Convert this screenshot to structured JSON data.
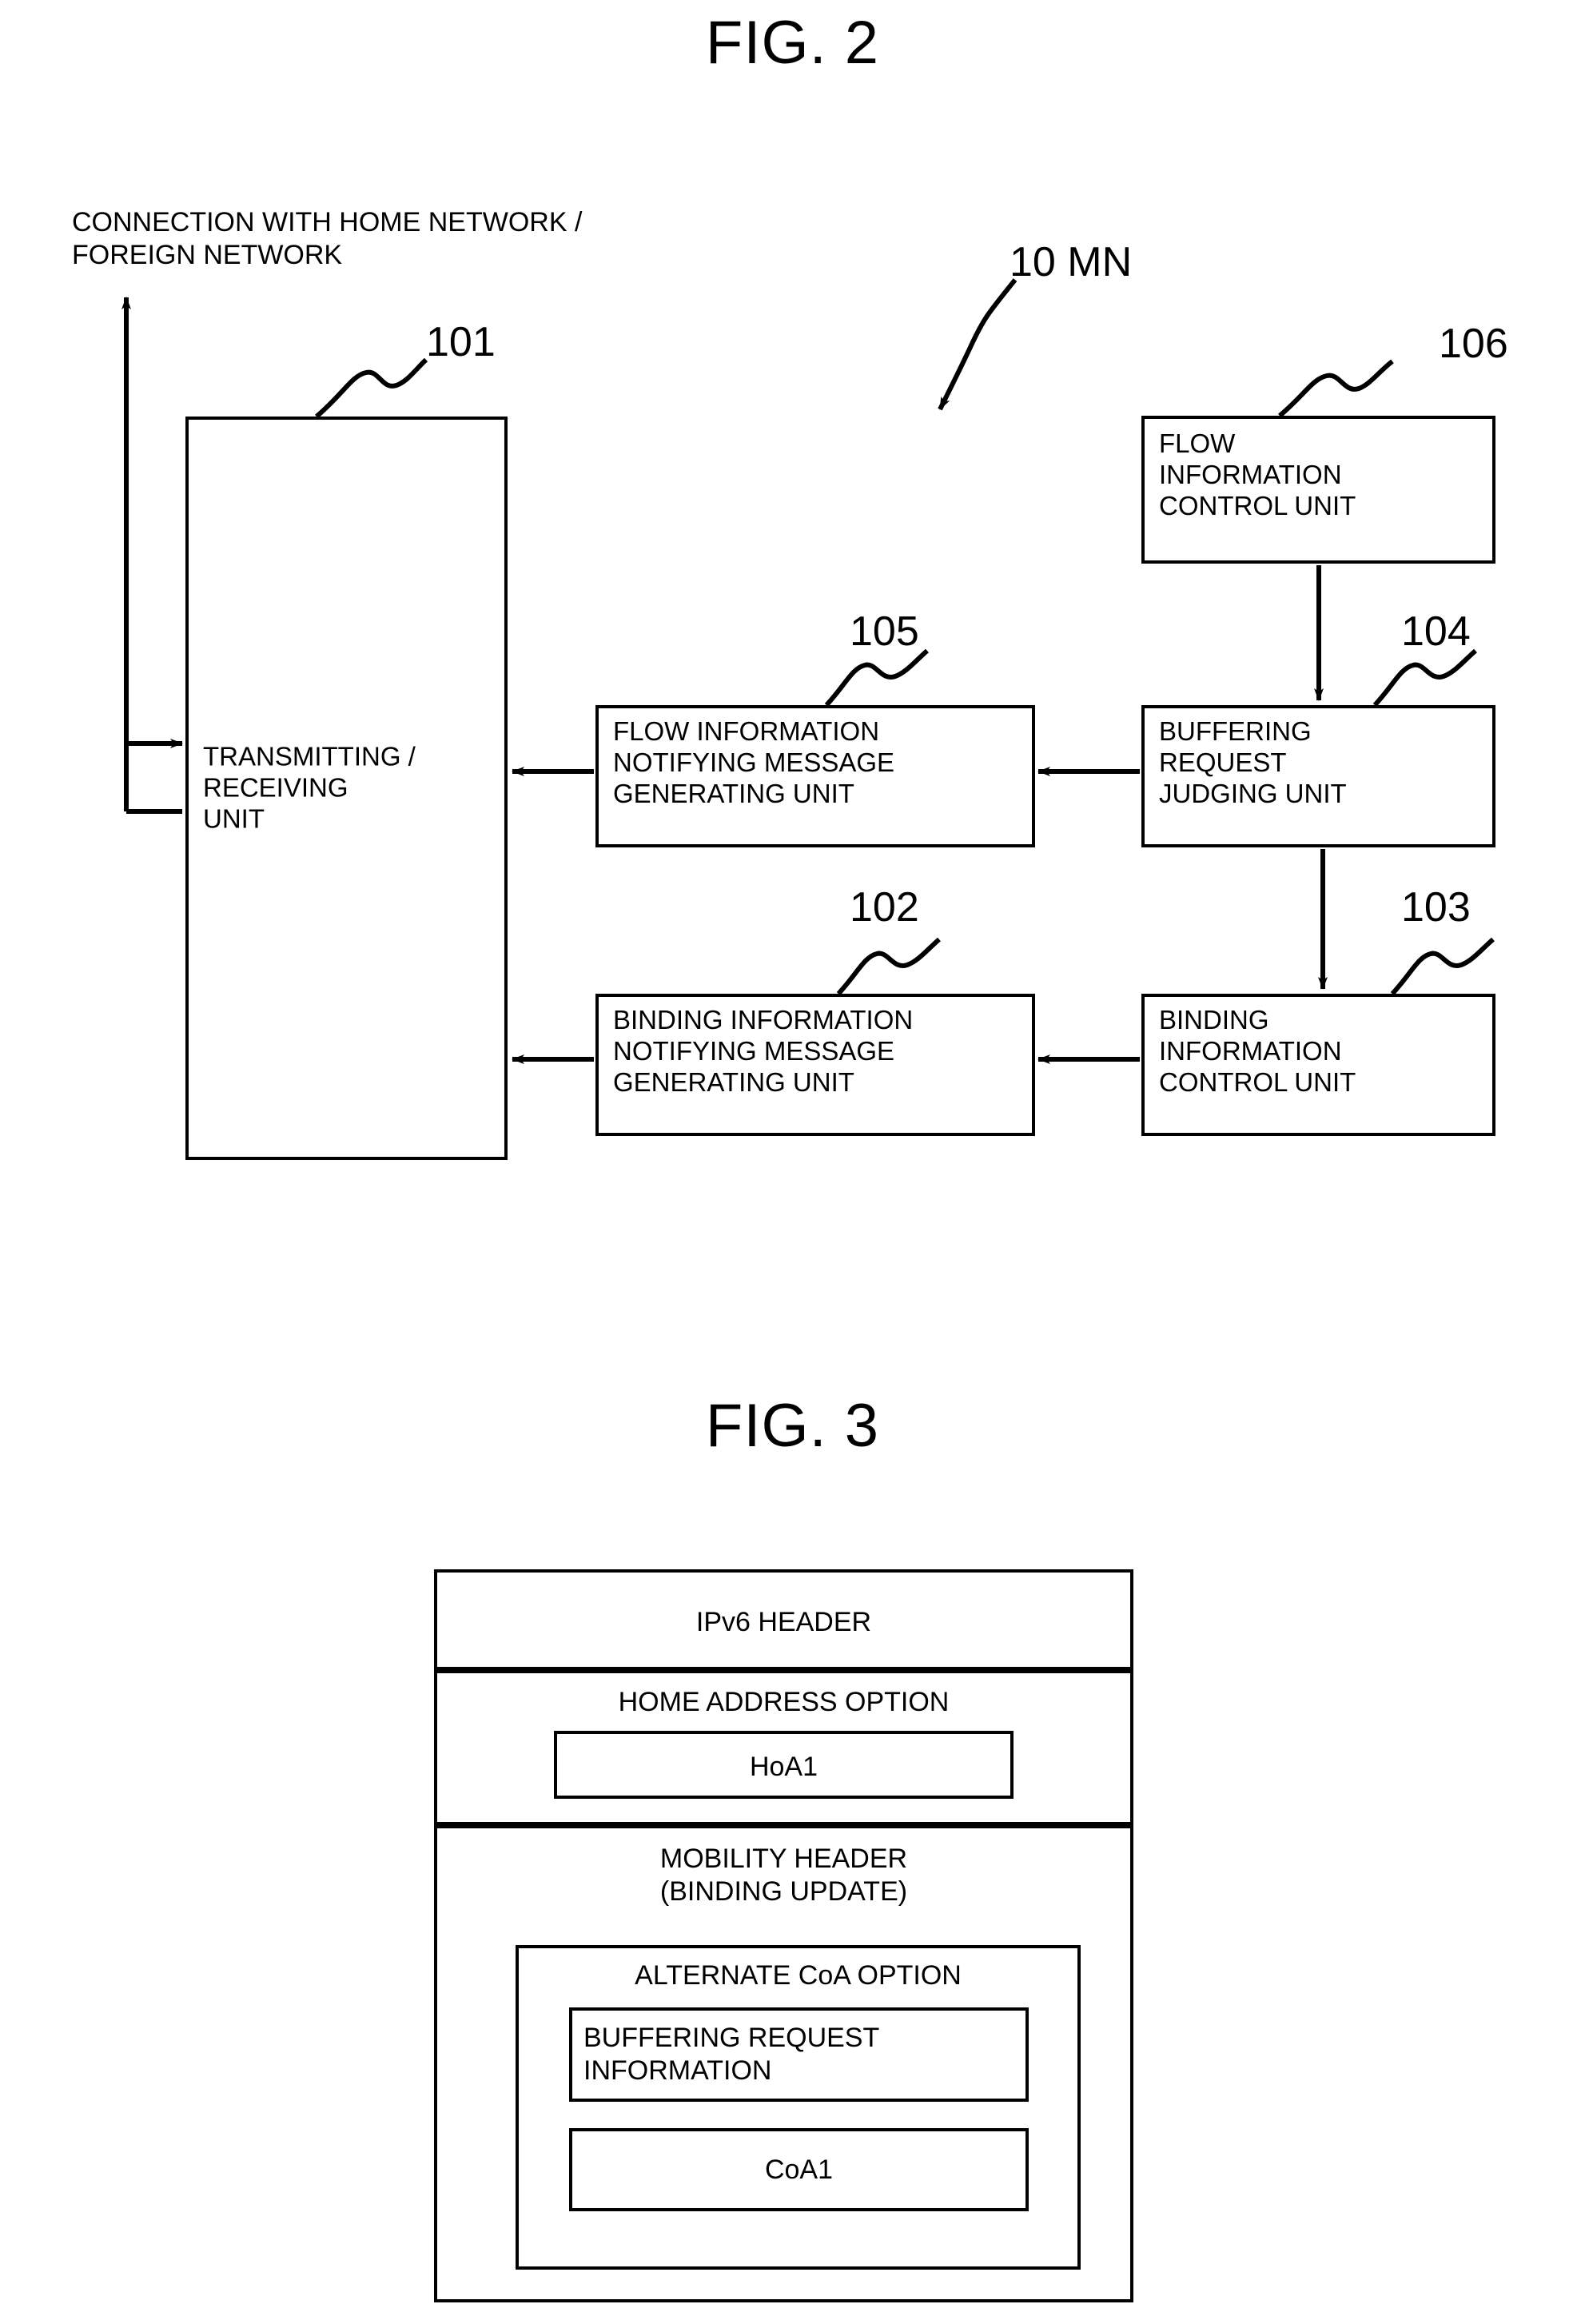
{
  "figures": {
    "fig2": {
      "title": "FIG. 2",
      "caption": "CONNECTION WITH HOME NETWORK /\nFOREIGN NETWORK",
      "device_label": "10 MN",
      "units": [
        {
          "ref": "101",
          "label": "TRANSMITTING /\nRECEIVING\nUNIT"
        },
        {
          "ref": "102",
          "label": "BINDING INFORMATION\nNOTIFYING MESSAGE\nGENERATING UNIT"
        },
        {
          "ref": "103",
          "label": "BINDING\nINFORMATION\nCONTROL UNIT"
        },
        {
          "ref": "104",
          "label": "BUFFERING\nREQUEST\nJUDGING UNIT"
        },
        {
          "ref": "105",
          "label": "FLOW INFORMATION\nNOTIFYING MESSAGE\nGENERATING UNIT"
        },
        {
          "ref": "106",
          "label": "FLOW\nINFORMATION\nCONTROL UNIT"
        }
      ]
    },
    "fig3": {
      "title": "FIG. 3",
      "rows": [
        {
          "label": "IPv6 HEADER"
        },
        {
          "label": "HOME ADDRESS OPTION",
          "inner": [
            {
              "label": "HoA1"
            }
          ]
        },
        {
          "label": "MOBILITY HEADER\n(BINDING UPDATE)",
          "inner": [
            {
              "label": "ALTERNATE CoA OPTION",
              "inner": [
                {
                  "label": "BUFFERING REQUEST\nINFORMATION"
                },
                {
                  "label": "CoA1"
                }
              ]
            }
          ]
        }
      ]
    }
  },
  "colors": {
    "ink": "#000000",
    "paper": "#ffffff"
  }
}
